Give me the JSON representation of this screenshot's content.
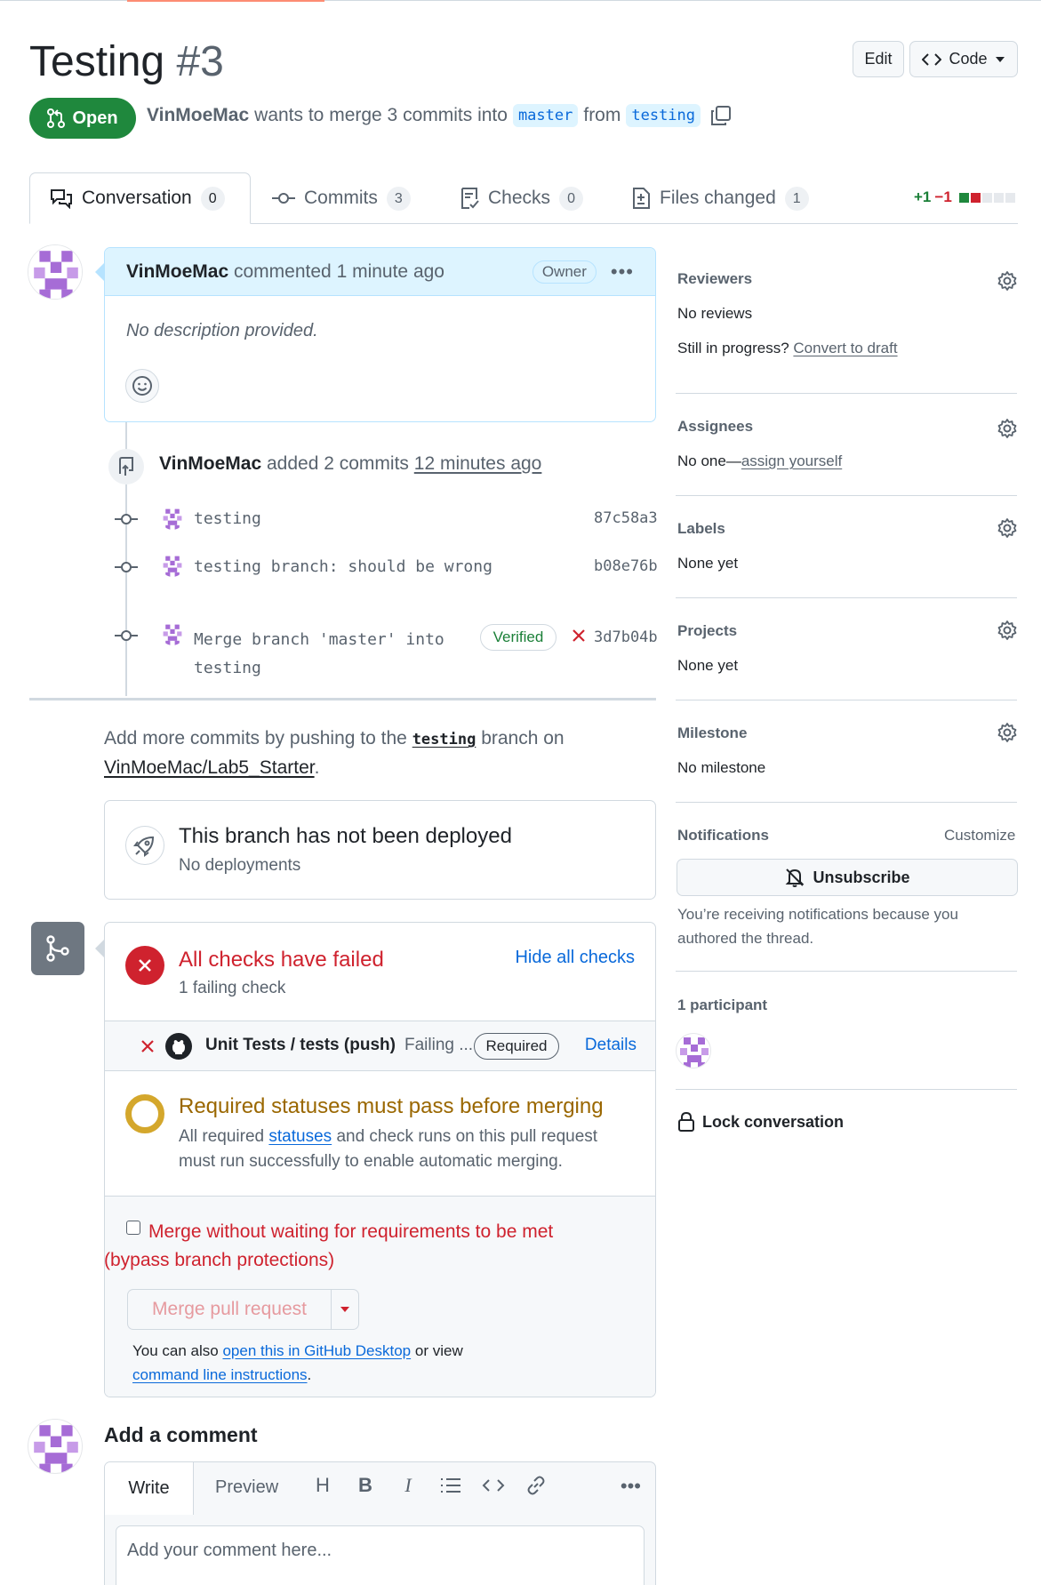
{
  "header": {
    "title": "Testing",
    "number": "#3",
    "edit_label": "Edit",
    "code_label": "Code"
  },
  "status": {
    "state": "Open",
    "author": "VinMoeMac",
    "text_mid": "wants to merge 3 commits into",
    "base_branch": "master",
    "from_text": "from",
    "head_branch": "testing"
  },
  "tabs": [
    {
      "label": "Conversation",
      "count": "0"
    },
    {
      "label": "Commits",
      "count": "3"
    },
    {
      "label": "Checks",
      "count": "0"
    },
    {
      "label": "Files changed",
      "count": "1"
    }
  ],
  "diffstat": {
    "added": "+1",
    "removed": "−1"
  },
  "comment": {
    "author": "VinMoeMac",
    "action": "commented",
    "time": "1 minute ago",
    "role": "Owner",
    "body": "No description provided."
  },
  "timeline": {
    "author": "VinMoeMac",
    "action": "added 2 commits",
    "time": "12 minutes ago",
    "commits": [
      {
        "message": "testing",
        "sha": "87c58a3"
      },
      {
        "message": "testing branch: should be wrong",
        "sha": "b08e76b"
      },
      {
        "message_line1": "Merge branch 'master' into",
        "message_line2": "testing",
        "verified": "Verified",
        "sha": "3d7b04b"
      }
    ]
  },
  "push_hint": {
    "prefix": "Add more commits by pushing to the",
    "branch": "testing",
    "middle": "branch on",
    "repo": "VinMoeMac/Lab5_Starter",
    "suffix": "."
  },
  "deploy": {
    "title": "This branch has not been deployed",
    "subtitle": "No deployments"
  },
  "checks": {
    "title": "All checks have failed",
    "subtitle": "1 failing check",
    "hide_label": "Hide all checks",
    "item": {
      "name": "Unit Tests / tests (push)",
      "status": "Failing ...",
      "required": "Required",
      "details": "Details"
    },
    "required_title": "Required statuses must pass before merging",
    "required_text_a": "All required",
    "required_link": "statuses",
    "required_text_b": "and check runs on this pull request",
    "required_text_c": "must run successfully to enable automatic merging.",
    "bypass_line1": "Merge without waiting for requirements to be met",
    "bypass_line2": "(bypass branch protections)",
    "merge_label": "Merge pull request",
    "also_prefix": "You can also",
    "desktop_link": "open this in GitHub Desktop",
    "or_view": "or view",
    "cli_link": "command line instructions",
    "cli_suffix": "."
  },
  "add_comment": {
    "title": "Add a comment",
    "write": "Write",
    "preview": "Preview",
    "placeholder": "Add your comment here..."
  },
  "sidebar": {
    "reviewers": {
      "title": "Reviewers",
      "value": "No reviews",
      "progress": "Still in progress?",
      "draft_link": "Convert to draft"
    },
    "assignees": {
      "title": "Assignees",
      "prefix": "No one—",
      "link": "assign yourself"
    },
    "labels": {
      "title": "Labels",
      "value": "None yet"
    },
    "projects": {
      "title": "Projects",
      "value": "None yet"
    },
    "milestone": {
      "title": "Milestone",
      "value": "No milestone"
    },
    "notifications": {
      "title": "Notifications",
      "customize": "Customize",
      "unsubscribe": "Unsubscribe",
      "reason_line1": "You’re receiving notifications because you",
      "reason_line2": "authored the thread."
    },
    "participants": {
      "title": "1 participant"
    },
    "lock": {
      "label": "Lock conversation"
    }
  },
  "colors": {
    "open_green": "#1f883d",
    "danger": "#cf222e",
    "attention": "#9a6700",
    "accent": "#0969da"
  }
}
